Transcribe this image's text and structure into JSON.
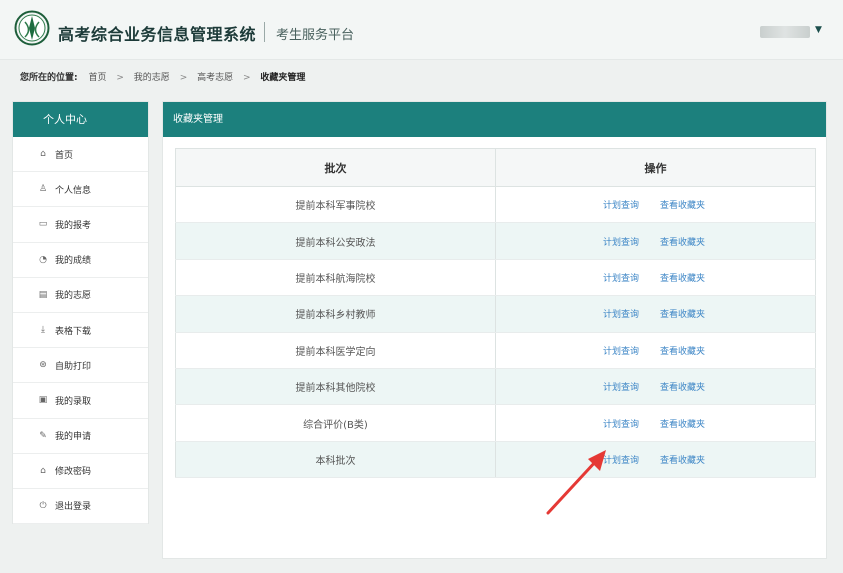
{
  "header": {
    "system_title": "高考综合业务信息管理系统",
    "subtitle": "考生服务平台",
    "user_menu_caret": "▼"
  },
  "breadcrumb": {
    "lead": "您所在的位置:",
    "items": [
      "首页",
      "我的志愿",
      "高考志愿",
      "收藏夹管理"
    ],
    "separator": ">"
  },
  "sidebar": {
    "title": "个人中心",
    "items": [
      {
        "label": "首页",
        "icon": "home-icon",
        "glyph": "⌂"
      },
      {
        "label": "个人信息",
        "icon": "user-icon",
        "glyph": "♙"
      },
      {
        "label": "我的报考",
        "icon": "id-card-icon",
        "glyph": "▭"
      },
      {
        "label": "我的成绩",
        "icon": "chart-icon",
        "glyph": "◔"
      },
      {
        "label": "我的志愿",
        "icon": "document-icon",
        "glyph": "▤"
      },
      {
        "label": "表格下载",
        "icon": "download-icon",
        "glyph": "⤓"
      },
      {
        "label": "自助打印",
        "icon": "print-icon",
        "glyph": "⊛"
      },
      {
        "label": "我的录取",
        "icon": "calendar-icon",
        "glyph": "▣"
      },
      {
        "label": "我的申请",
        "icon": "edit-icon",
        "glyph": "✎"
      },
      {
        "label": "修改密码",
        "icon": "lock-icon",
        "glyph": "⌂"
      },
      {
        "label": "退出登录",
        "icon": "logout-icon",
        "glyph": "⏻"
      }
    ]
  },
  "main": {
    "panel_title": "收藏夹管理",
    "columns": [
      "批次",
      "操作"
    ],
    "rows": [
      {
        "batch": "提前本科军事院校",
        "op1": "计划查询",
        "op2": "查看收藏夹"
      },
      {
        "batch": "提前本科公安政法",
        "op1": "计划查询",
        "op2": "查看收藏夹"
      },
      {
        "batch": "提前本科航海院校",
        "op1": "计划查询",
        "op2": "查看收藏夹"
      },
      {
        "batch": "提前本科乡村教师",
        "op1": "计划查询",
        "op2": "查看收藏夹"
      },
      {
        "batch": "提前本科医学定向",
        "op1": "计划查询",
        "op2": "查看收藏夹"
      },
      {
        "batch": "提前本科其他院校",
        "op1": "计划查询",
        "op2": "查看收藏夹"
      },
      {
        "batch": "综合评价(B类)",
        "op1": "计划查询",
        "op2": "查看收藏夹"
      },
      {
        "batch": "本科批次",
        "op1": "计划查询",
        "op2": "查看收藏夹"
      }
    ]
  },
  "colors": {
    "accent": "#1c807d",
    "link": "#3d86c6",
    "annotation_arrow": "#e53935"
  }
}
